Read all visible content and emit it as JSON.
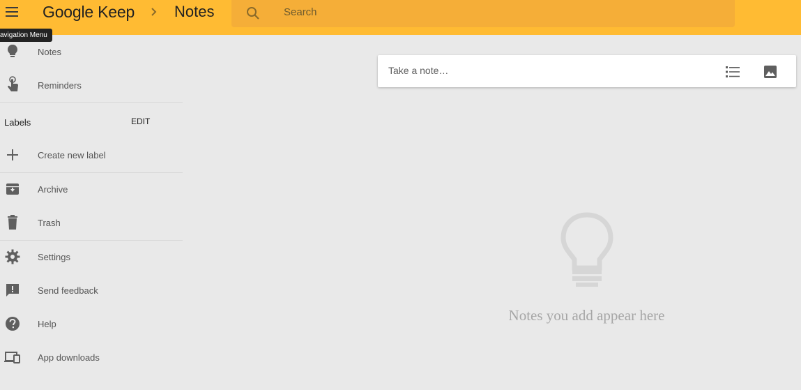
{
  "header": {
    "app_name": "Google Keep",
    "breadcrumb_current": "Notes",
    "search_placeholder": "Search",
    "background_color": "#ffbb33"
  },
  "tooltip": {
    "text": "avigation Menu"
  },
  "sidebar": {
    "items_top": [
      {
        "label": "Notes",
        "icon": "lightbulb-icon"
      },
      {
        "label": "Reminders",
        "icon": "reminder-hand-icon"
      }
    ],
    "labels_heading": "Labels",
    "labels_edit": "EDIT",
    "create_label": {
      "label": "Create new label",
      "icon": "plus-icon"
    },
    "items_mid": [
      {
        "label": "Archive",
        "icon": "archive-icon"
      },
      {
        "label": "Trash",
        "icon": "trash-icon"
      }
    ],
    "items_bottom": [
      {
        "label": "Settings",
        "icon": "gear-icon"
      },
      {
        "label": "Send feedback",
        "icon": "feedback-icon"
      },
      {
        "label": "Help",
        "icon": "help-icon"
      },
      {
        "label": "App downloads",
        "icon": "devices-icon"
      }
    ]
  },
  "note_input": {
    "placeholder": "Take a note…"
  },
  "empty_state": {
    "message": "Notes you add appear here"
  }
}
